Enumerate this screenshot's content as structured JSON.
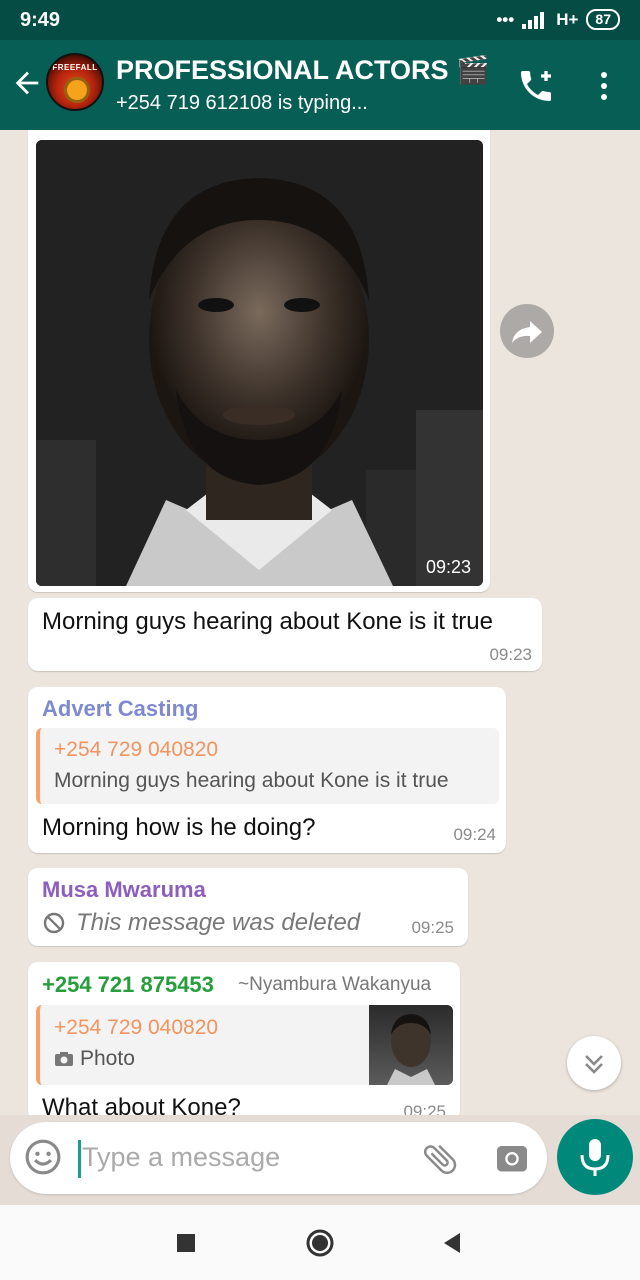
{
  "status_bar": {
    "time": "9:49",
    "network": "H+",
    "battery": "87"
  },
  "header": {
    "avatar_label": "FREEFALL",
    "title": "PROFESSIONAL ACTORS 🎬",
    "subtitle": "+254 719 612108 is typing..."
  },
  "messages": {
    "photo_time": "09:23",
    "msg1": {
      "text": "Morning guys hearing about Kone is it true",
      "time": "09:23"
    },
    "msg2": {
      "sender": "Advert Casting",
      "sender_color": "#7e8ad0",
      "quote_name": "+254 729 040820",
      "quote_text": "Morning guys hearing about Kone is it true",
      "text": "Morning how is he doing?",
      "time": "09:24"
    },
    "msg3": {
      "sender": "Musa Mwaruma",
      "sender_color": "#8c5fbf",
      "deleted_text": "This message was deleted",
      "time": "09:25"
    },
    "msg4": {
      "phone": "+254 721 875453",
      "alias": "~Nyambura Wakanyua",
      "quote_name": "+254 729 040820",
      "quote_type": "Photo",
      "text": "What about Kone?",
      "time": "09:25"
    }
  },
  "input": {
    "placeholder": "Type a message",
    "value": ""
  },
  "colors": {
    "header": "#075e54",
    "status_bar": "#054d44",
    "accent": "#00897b"
  }
}
